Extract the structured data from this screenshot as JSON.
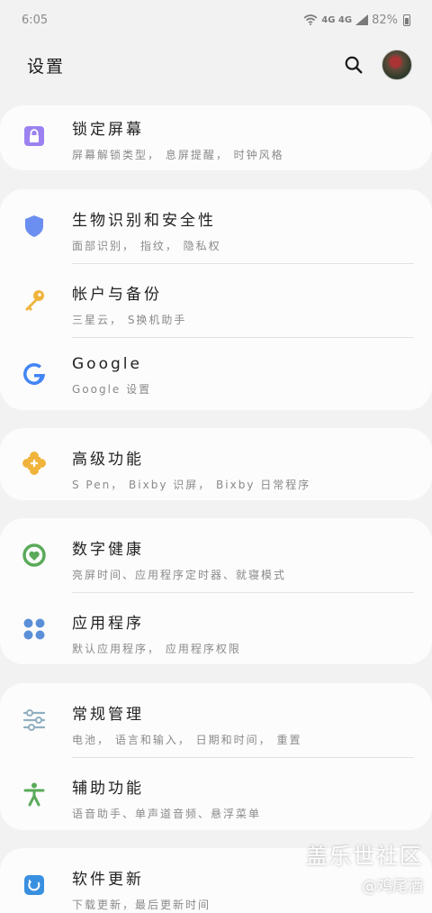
{
  "status_bar": {
    "time": "6:05",
    "network": "4G 4G",
    "battery": "82%"
  },
  "header": {
    "title": "设置"
  },
  "sections": [
    {
      "items": [
        {
          "title": "锁定屏幕",
          "subtitle": "屏幕解锁类型， 息屏提醒， 时钟风格"
        }
      ]
    },
    {
      "items": [
        {
          "title": "生物识别和安全性",
          "subtitle": "面部识别， 指纹， 隐私权"
        },
        {
          "title": "帐户与备份",
          "subtitle": "三星云， S换机助手"
        },
        {
          "title": "Google",
          "subtitle": "Google 设置"
        }
      ]
    },
    {
      "items": [
        {
          "title": "高级功能",
          "subtitle": "S Pen， Bixby 识屏， Bixby 日常程序"
        }
      ]
    },
    {
      "items": [
        {
          "title": "数字健康",
          "subtitle": "亮屏时间、应用程序定时器、就寝模式"
        },
        {
          "title": "应用程序",
          "subtitle": "默认应用程序， 应用程序权限"
        }
      ]
    },
    {
      "items": [
        {
          "title": "常规管理",
          "subtitle": "电池， 语言和输入， 日期和时间， 重置"
        },
        {
          "title": "辅助功能",
          "subtitle": "语音助手、单声道音频、悬浮菜单"
        }
      ]
    },
    {
      "items": [
        {
          "title": "软件更新",
          "subtitle": "下载更新，最后更新时间"
        }
      ]
    }
  ],
  "watermark": {
    "line1": "盖乐世社区",
    "line2": "@鸡尾酒"
  },
  "colors": {
    "lock": "#9b82f0",
    "shield": "#6b8ff0",
    "key": "#f0b43c",
    "google_blue": "#4285f4",
    "puzzle": "#f0b43c",
    "wellbeing": "#5aaa5a",
    "apps": "#5b8fd8",
    "general": "#8fb0c0",
    "accessibility": "#5aaa5a",
    "update": "#3a90e0"
  }
}
